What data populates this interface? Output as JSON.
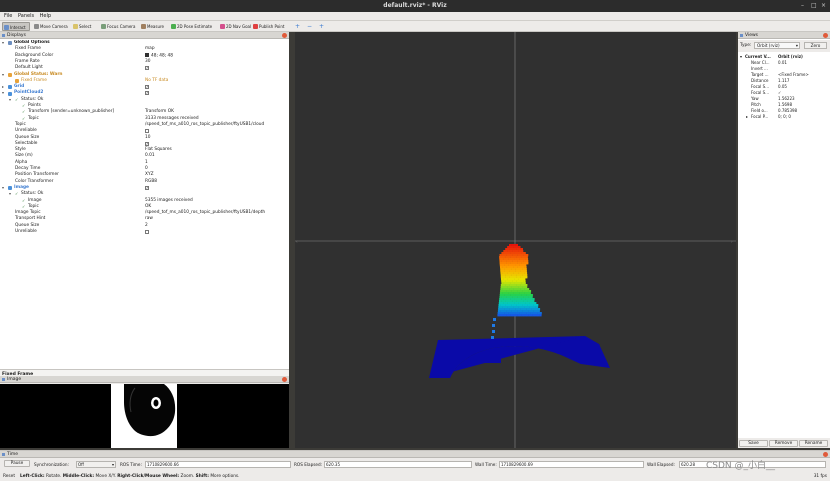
{
  "window": {
    "title": "default.rviz* - RViz"
  },
  "menu": [
    "File",
    "Panels",
    "Help"
  ],
  "toolbar": [
    {
      "label": "Interact",
      "color": "#6a8fc8",
      "active": true
    },
    {
      "label": "Move Camera",
      "color": "#8a8a8a"
    },
    {
      "label": "Select",
      "color": "#d9c36a"
    },
    {
      "label": "Focus Camera",
      "color": "#7a9e7a"
    },
    {
      "label": "Measure",
      "color": "#a08060"
    },
    {
      "label": "2D Pose Estimate",
      "color": "#4caf50"
    },
    {
      "label": "2D Nav Goal",
      "color": "#d44f8c"
    },
    {
      "label": "Publish Point",
      "color": "#e04040"
    }
  ],
  "displays": {
    "title": "Displays",
    "rows": [
      {
        "indent": 0,
        "expand": "▾",
        "icon": "#6c8ebf",
        "key": "Global Options",
        "value": ""
      },
      {
        "indent": 1,
        "key": "Fixed Frame",
        "value": "map"
      },
      {
        "indent": 1,
        "key": "Background Color",
        "value": "48; 48; 48",
        "swatch": "#303030"
      },
      {
        "indent": 1,
        "key": "Frame Rate",
        "value": "30"
      },
      {
        "indent": 1,
        "key": "Default Light",
        "check": true
      },
      {
        "indent": 0,
        "expand": "▾",
        "icon": "#e8a33a",
        "key": "Global Status: Warn",
        "value": "",
        "color": "#c88a20"
      },
      {
        "indent": 1,
        "icon": "#e8a33a",
        "key": "Fixed Frame",
        "value": "No TF data",
        "color": "#c88a20"
      },
      {
        "indent": 0,
        "expand": "▸",
        "icon": "#4a90d9",
        "key": "Grid",
        "check": true,
        "color": "#3a7ad0"
      },
      {
        "indent": 0,
        "expand": "▾",
        "icon": "#4a90d9",
        "key": "PointCloud2",
        "check": true,
        "color": "#3a7ad0"
      },
      {
        "indent": 1,
        "expand": "▾",
        "tick": true,
        "key": "Status: Ok",
        "value": ""
      },
      {
        "indent": 2,
        "tick": true,
        "key": "Points",
        "value": ""
      },
      {
        "indent": 2,
        "tick": true,
        "key": "Transform [sender=unknown_publisher]",
        "value": "Transform OK"
      },
      {
        "indent": 2,
        "tick": true,
        "key": "Topic",
        "value": "3133 messages received"
      },
      {
        "indent": 1,
        "key": "Topic",
        "value": "/speed_tof_ms_a010_ros_topic_publisher/ftyUSB1/cloud"
      },
      {
        "indent": 1,
        "key": "Unreliable",
        "check": false
      },
      {
        "indent": 1,
        "key": "Queue Size",
        "value": "10"
      },
      {
        "indent": 1,
        "key": "Selectable",
        "check": true
      },
      {
        "indent": 1,
        "key": "Style",
        "value": "Flat Squares"
      },
      {
        "indent": 1,
        "key": "Size (m)",
        "value": "0.01"
      },
      {
        "indent": 1,
        "key": "Alpha",
        "value": "1"
      },
      {
        "indent": 1,
        "key": "Decay Time",
        "value": "0"
      },
      {
        "indent": 1,
        "key": "Position Transformer",
        "value": "XYZ"
      },
      {
        "indent": 1,
        "key": "Color Transformer",
        "value": "RGB8"
      },
      {
        "indent": 0,
        "expand": "▾",
        "icon": "#4a90d9",
        "key": "Image",
        "check": true,
        "color": "#3a7ad0"
      },
      {
        "indent": 1,
        "expand": "▾",
        "tick": true,
        "key": "Status: Ok",
        "value": ""
      },
      {
        "indent": 2,
        "tick": true,
        "key": "Image",
        "value": "5355 images received"
      },
      {
        "indent": 2,
        "tick": true,
        "key": "Topic",
        "value": "OK"
      },
      {
        "indent": 1,
        "key": "Image Topic",
        "value": "/speed_tof_ms_a010_ros_topic_publisher/ftyUSB1/depth"
      },
      {
        "indent": 1,
        "key": "Transport Hint",
        "value": "raw"
      },
      {
        "indent": 1,
        "key": "Queue Size",
        "value": "2"
      },
      {
        "indent": 1,
        "key": "Unreliable",
        "check": false
      }
    ],
    "description_title": "Fixed Frame",
    "description_body": "Frame into which all data is transformed before being displayed.",
    "buttons": [
      "Add",
      "Duplicate",
      "Remove",
      "Rename"
    ]
  },
  "image_panel": {
    "title": "Image"
  },
  "views": {
    "title": "Views",
    "type_label": "Type:",
    "type_value": "Orbit (rviz)",
    "zero_label": "Zero",
    "rows": [
      {
        "indent": 0,
        "expand": "▾",
        "key": "Current V...",
        "value": "Orbit (rviz)",
        "bold": true
      },
      {
        "indent": 1,
        "key": "Near Cl...",
        "value": "0.01"
      },
      {
        "indent": 1,
        "key": "Invert ...",
        "value": ""
      },
      {
        "indent": 1,
        "key": "Target ...",
        "value": "<Fixed Frame>"
      },
      {
        "indent": 1,
        "key": "Distance",
        "value": "1.117"
      },
      {
        "indent": 1,
        "key": "Focal S...",
        "value": "0.05"
      },
      {
        "indent": 1,
        "key": "Focal S...",
        "value": "✓"
      },
      {
        "indent": 1,
        "key": "Yaw",
        "value": "1.56223"
      },
      {
        "indent": 1,
        "key": "Pitch",
        "value": "1.5698"
      },
      {
        "indent": 1,
        "key": "Field o...",
        "value": "0.785398"
      },
      {
        "indent": 1,
        "expand": "▸",
        "key": "Focal P...",
        "value": "0; 0; 0"
      }
    ],
    "buttons": [
      "Save",
      "Remove",
      "Rename"
    ]
  },
  "time": {
    "title": "Time",
    "pause": "Pause",
    "sync_label": "Synchronization:",
    "sync_value": "Off",
    "ros_time_label": "ROS Time:",
    "ros_time": "1710829600.66",
    "ros_elapsed_label": "ROS Elapsed:",
    "ros_elapsed": "620.35",
    "wall_time_label": "Wall Time:",
    "wall_time": "1710829600.69",
    "wall_elapsed_label": "Wall Elapsed:",
    "wall_elapsed": "620.28"
  },
  "status": {
    "reset": "Reset",
    "hint_bold1": "Left-Click:",
    "hint1": "Rotate.",
    "hint_bold2": "Middle-Click:",
    "hint2": "Move X/Y.",
    "hint_bold3": "Right-Click/Mouse Wheel:",
    "hint3": "Zoom.",
    "hint_bold4": "Shift:",
    "hint4": "More options.",
    "fps": "31 fps",
    "watermark": "CSDN @_小白__"
  }
}
